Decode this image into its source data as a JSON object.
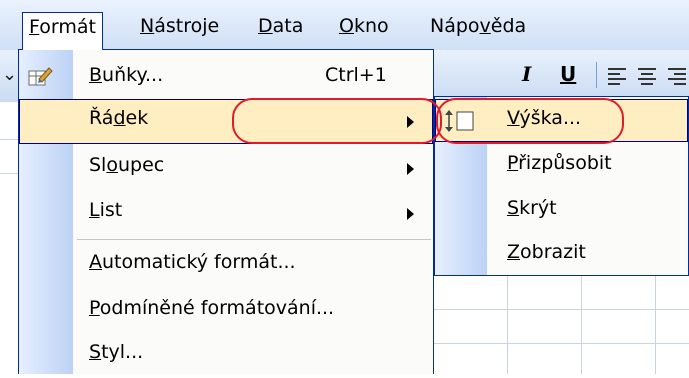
{
  "menubar": {
    "items": [
      {
        "text": "Formát",
        "ul": "F",
        "rest": "ormát"
      },
      {
        "text": "Nástroje",
        "ul": "N",
        "rest": "ástroje"
      },
      {
        "text": "Data",
        "ul": "D",
        "rest": "ata"
      },
      {
        "text": "Okno",
        "ul": "O",
        "rest": "kno"
      },
      {
        "text": "Nápověda",
        "pre": "Nápo",
        "ul": "v",
        "rest": "ěda"
      }
    ]
  },
  "toolbar": {
    "italic": "I",
    "underline": "U"
  },
  "format_menu": {
    "items": [
      {
        "pre": "",
        "ul": "B",
        "rest": "uňky...",
        "shortcut": "Ctrl+1",
        "submenu": false,
        "icon": "format-cells-icon"
      },
      {
        "pre": "Řá",
        "ul": "d",
        "rest": "ek",
        "submenu": true,
        "highlighted": true
      },
      {
        "pre": "Sl",
        "ul": "o",
        "rest": "upec",
        "submenu": true
      },
      {
        "pre": "",
        "ul": "L",
        "rest": "ist",
        "submenu": true
      },
      {
        "pre": "",
        "ul": "A",
        "rest": "utomatický formát..."
      },
      {
        "pre": "",
        "ul": "P",
        "rest": "odmíněné formátování..."
      },
      {
        "pre": "",
        "ul": "S",
        "rest": "tyl..."
      }
    ]
  },
  "row_submenu": {
    "items": [
      {
        "pre": "",
        "ul": "V",
        "rest": "ýška...",
        "highlighted": true,
        "icon": "row-height-icon"
      },
      {
        "pre": "",
        "ul": "P",
        "rest": "řizpůsobit"
      },
      {
        "pre": "",
        "ul": "S",
        "rest": "krýt"
      },
      {
        "pre": "",
        "ul": "Z",
        "rest": "obrazit"
      }
    ]
  },
  "colors": {
    "menu_highlight": "#ffeec2",
    "menu_border": "#002d96",
    "annotation": "#e21a2c"
  }
}
